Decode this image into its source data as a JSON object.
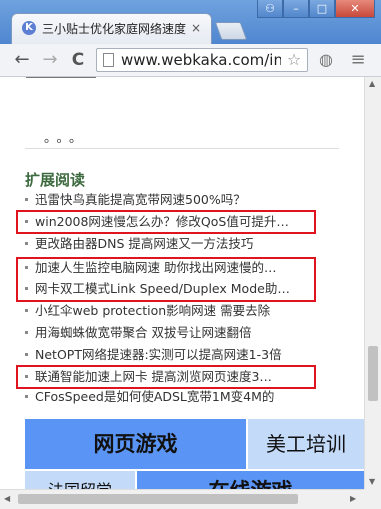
{
  "browser": {
    "tab_title": "三小贴士优化家庭网络速度",
    "tab_favicon": "K",
    "tab_close": "×",
    "url": "www.webkaka.com/in",
    "window_controls": {
      "user": "⚇",
      "minimize": "–",
      "maximize": "□",
      "close": "✕"
    },
    "icons": {
      "back": "←",
      "forward": "→",
      "reload": "C",
      "bookmark": "☆",
      "globe": "◍",
      "menu": "≡"
    }
  },
  "content": {
    "ellipsis": "。。。",
    "section_title": "扩展阅读",
    "items": [
      {
        "text": "迅雷快鸟真能提高宽带网速500%吗？",
        "highlighted": false
      },
      {
        "text": "win2008网速慢怎么办？修改QoS值可提升…",
        "highlighted": true
      },
      {
        "text": "更改路由器DNS 提高网速又一方法技巧",
        "highlighted": false
      },
      {
        "text": "加速人生监控电脑网速 助你找出网速慢的…",
        "highlighted": true
      },
      {
        "text": "网卡双工模式Link Speed/Duplex Mode助…",
        "highlighted": true
      },
      {
        "text": "小红伞web protection影响网速 需要去除",
        "highlighted": false
      },
      {
        "text": "用海蜘蛛做宽带聚合 双拔号让网速翻倍",
        "highlighted": false
      },
      {
        "text": "NetOPT网络提速器:实测可以提高网速1-3倍",
        "highlighted": false
      },
      {
        "text": "联通智能加速上网卡 提高浏览网页速度3…",
        "highlighted": true
      },
      {
        "text": "CFosSpeed是如何使ADSL宽带1M变4M的",
        "highlighted": false
      }
    ],
    "ads": {
      "web_games": "网页游戏",
      "art_training": "美工培训",
      "bottom_left_partial": "法国留学",
      "bottom_right_partial": "在线游戏"
    }
  },
  "colors": {
    "titlebar": "#5a8fd5",
    "section_title": "#3d6a3f",
    "highlight_box": "#e0141e",
    "ad_blue": "#5a95f5",
    "ad_light": "#c3dbf9"
  }
}
